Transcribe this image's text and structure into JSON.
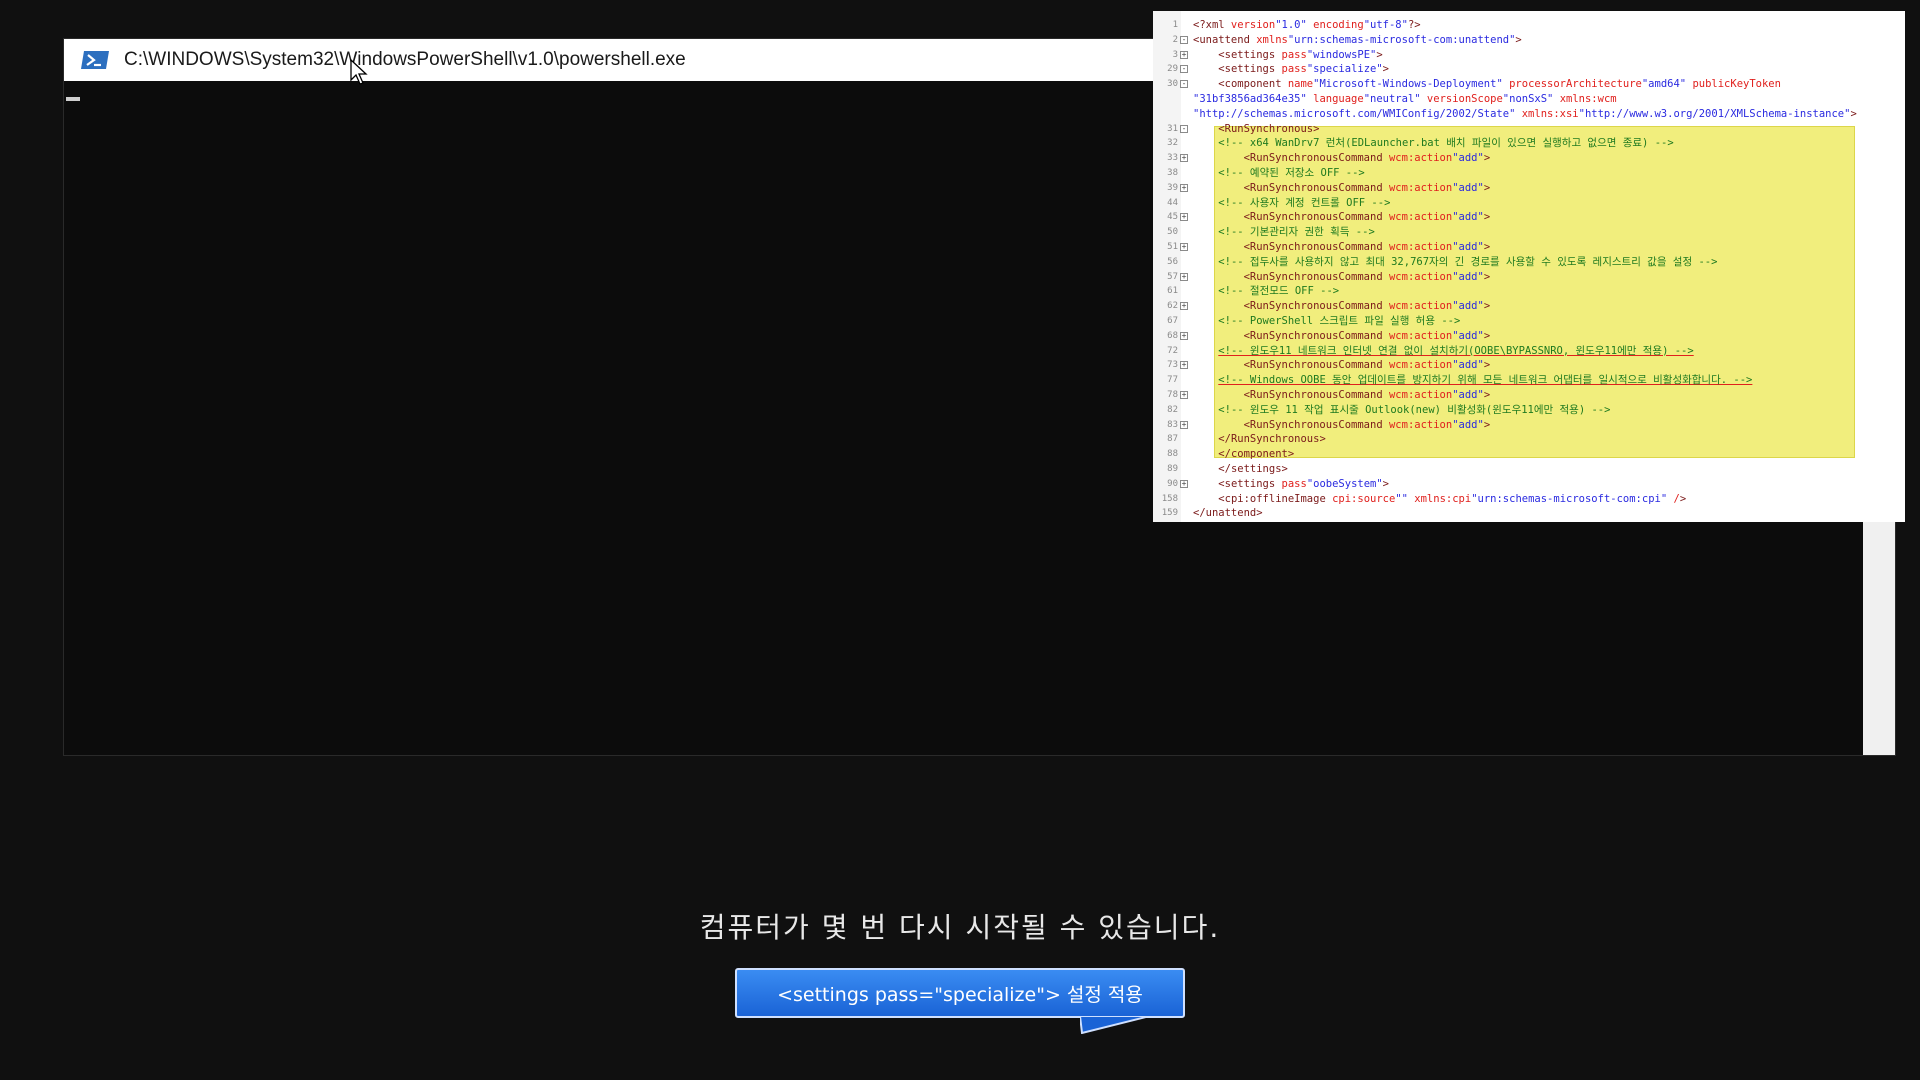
{
  "powershell": {
    "title": "C:\\WINDOWS\\System32\\WindowsPowerShell\\v1.0\\powershell.exe",
    "icon": "powershell-icon"
  },
  "xml": {
    "lines": [
      {
        "n": "1",
        "fold": "",
        "text": "<?xml version=\"1.0\" encoding=\"utf-8\"?>"
      },
      {
        "n": "2",
        "fold": "-",
        "text": "<unattend xmlns=\"urn:schemas-microsoft-com:unattend\">"
      },
      {
        "n": "3",
        "fold": "+",
        "text": "    <settings pass=\"windowsPE\">"
      },
      {
        "n": "29",
        "fold": "-",
        "text": "    <settings pass=\"specialize\">"
      },
      {
        "n": "30",
        "fold": "-",
        "text": "    <component name=\"Microsoft-Windows-Deployment\" processorArchitecture=\"amd64\" publicKeyToken="
      },
      {
        "n": "",
        "fold": "",
        "text": "\"31bf3856ad364e35\" language=\"neutral\" versionScope=\"nonSxS\" xmlns:wcm="
      },
      {
        "n": "",
        "fold": "",
        "text": "\"http://schemas.microsoft.com/WMIConfig/2002/State\" xmlns:xsi=\"http://www.w3.org/2001/XMLSchema-instance\">"
      },
      {
        "n": "31",
        "fold": "-",
        "text": "    <RunSynchronous>"
      },
      {
        "n": "32",
        "fold": "",
        "text": "    <!-- x64 WanDrv7 런처(EDLauncher.bat 배치 파일이 있으면 실행하고 없으면 종료) -->"
      },
      {
        "n": "33",
        "fold": "+",
        "text": "        <RunSynchronousCommand wcm:action=\"add\">"
      },
      {
        "n": "38",
        "fold": "",
        "text": "    <!-- 예약된 저장소 OFF -->"
      },
      {
        "n": "39",
        "fold": "+",
        "text": "        <RunSynchronousCommand wcm:action=\"add\">"
      },
      {
        "n": "44",
        "fold": "",
        "text": "    <!-- 사용자 계정 컨트롤 OFF -->"
      },
      {
        "n": "45",
        "fold": "+",
        "text": "        <RunSynchronousCommand wcm:action=\"add\">"
      },
      {
        "n": "50",
        "fold": "",
        "text": "    <!-- 기본관리자 권한 획득 -->"
      },
      {
        "n": "51",
        "fold": "+",
        "text": "        <RunSynchronousCommand wcm:action=\"add\">"
      },
      {
        "n": "56",
        "fold": "",
        "text": "    <!-- 접두사를 사용하지 않고 최대 32,767자의 긴 경로를 사용할 수 있도록 레지스트리 값을 설정 -->"
      },
      {
        "n": "57",
        "fold": "+",
        "text": "        <RunSynchronousCommand wcm:action=\"add\">"
      },
      {
        "n": "61",
        "fold": "",
        "text": "    <!-- 절전모드 OFF -->"
      },
      {
        "n": "62",
        "fold": "+",
        "text": "        <RunSynchronousCommand wcm:action=\"add\">"
      },
      {
        "n": "67",
        "fold": "",
        "text": "    <!-- PowerShell 스크립트 파일 실행 허용 -->"
      },
      {
        "n": "68",
        "fold": "+",
        "text": "        <RunSynchronousCommand wcm:action=\"add\">"
      },
      {
        "n": "72",
        "fold": "",
        "text": "    <!-- 윈도우11 네트워크 인터넷 연결 없이 설치하기(OOBE\\BYPASSNRO, 윈도우11에만 적용) -->"
      },
      {
        "n": "73",
        "fold": "+",
        "text": "        <RunSynchronousCommand wcm:action=\"add\">"
      },
      {
        "n": "77",
        "fold": "",
        "text": "    <!-- Windows OOBE 동안 업데이트를 방지하기 위해 모든 네트워크 어댑터를 일시적으로 비활성화합니다. -->"
      },
      {
        "n": "78",
        "fold": "+",
        "text": "        <RunSynchronousCommand wcm:action=\"add\">"
      },
      {
        "n": "82",
        "fold": "",
        "text": "    <!-- 윈도우 11 작업 표시줄 Outlook(new) 비활성화(윈도우11에만 적용) -->"
      },
      {
        "n": "83",
        "fold": "+",
        "text": "        <RunSynchronousCommand wcm:action=\"add\">"
      },
      {
        "n": "87",
        "fold": "",
        "text": "    </RunSynchronous>"
      },
      {
        "n": "88",
        "fold": "",
        "text": "    </component>"
      },
      {
        "n": "89",
        "fold": "",
        "text": "    </settings>"
      },
      {
        "n": "90",
        "fold": "+",
        "text": "    <settings pass=\"oobeSystem\">"
      },
      {
        "n": "158",
        "fold": "",
        "text": "    <cpi:offlineImage cpi:source=\"\" xmlns:cpi=\"urn:schemas-microsoft-com:cpi\" />"
      },
      {
        "n": "159",
        "fold": "",
        "text": "</unattend>"
      }
    ]
  },
  "status": {
    "message": "컴퓨터가 몇 번 다시 시작될 수 있습니다."
  },
  "callout": {
    "label": "<settings pass=\"specialize\"> 설정 적용"
  },
  "colors": {
    "highlight": "#f1ee7d",
    "callout": "#2a74e4",
    "background": "#101010"
  }
}
